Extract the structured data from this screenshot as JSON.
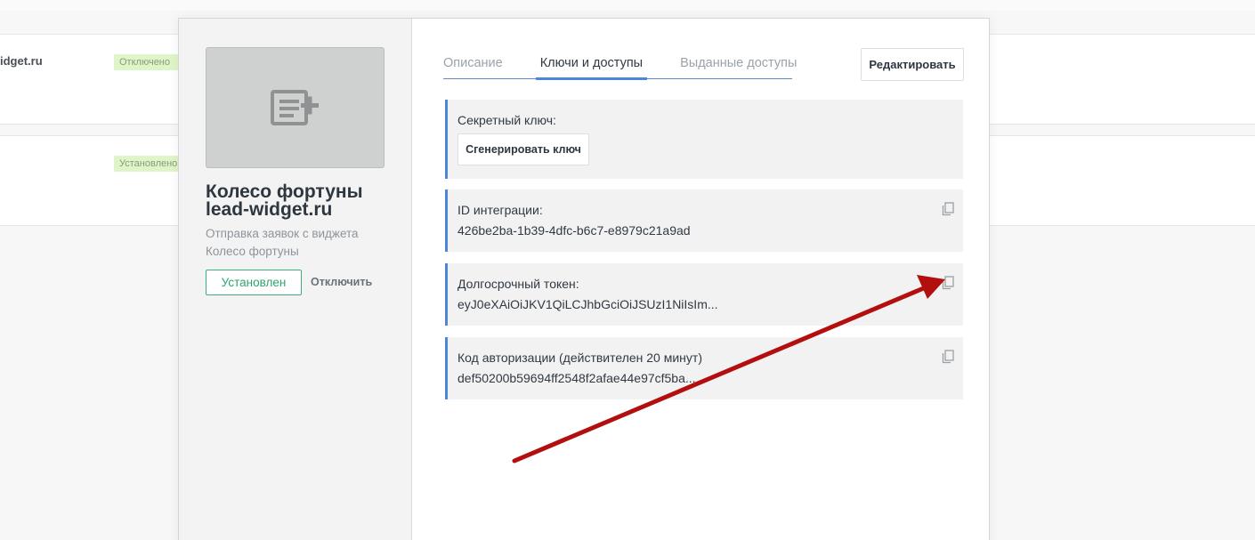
{
  "background_list": {
    "rows": [
      {
        "name": "idget.ru",
        "status": "Отключено"
      },
      {
        "name": "",
        "status": "Установлено"
      }
    ]
  },
  "widget": {
    "title_line1": "Колесо фортуны",
    "title_line2": "lead-widget.ru",
    "description": "Отправка заявок с виджета Колесо фортуны",
    "installed_label": "Установлен",
    "disable_label": "Отключить"
  },
  "tabs": [
    {
      "label": "Описание",
      "active": false
    },
    {
      "label": "Ключи и доступы",
      "active": true
    },
    {
      "label": "Выданные доступы",
      "active": false
    }
  ],
  "edit_button": "Редактировать",
  "fields": {
    "secret_key": {
      "label": "Секретный ключ:",
      "button": "Сгенерировать ключ"
    },
    "integration_id": {
      "label": "ID интеграции:",
      "value": "426be2ba-1b39-4dfc-b6c7-e8979c21a9ad"
    },
    "long_token": {
      "label": "Долгосрочный токен:",
      "value": "eyJ0eXAiOiJKV1QiLCJhbGciOiJSUzI1NiIsIm..."
    },
    "auth_code": {
      "label": "Код авторизации (действителен 20 минут)",
      "value": "def50200b59694ff2548f2afae44e97cf5ba..."
    }
  },
  "colors": {
    "accent_blue": "#4c86d8",
    "installed_green": "#2fa36e",
    "annotation_red": "#b30f0f"
  },
  "icons": {
    "preview": "widget-placeholder-icon",
    "copy": "copy-icon",
    "annotation": "red-arrow-annotation"
  }
}
